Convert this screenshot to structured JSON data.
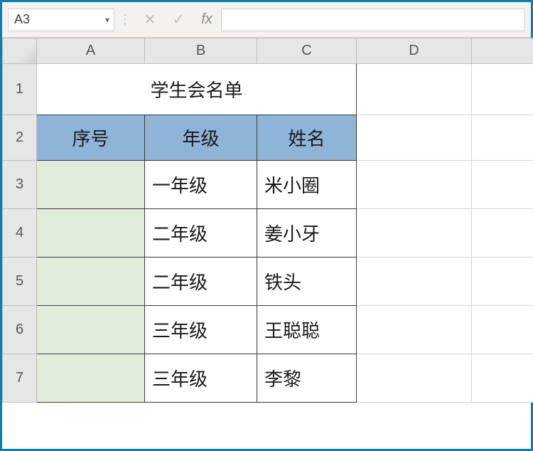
{
  "namebox": {
    "value": "A3"
  },
  "formula": {
    "value": ""
  },
  "fx_label": "fx",
  "columns": [
    "A",
    "B",
    "C",
    "D"
  ],
  "rows": [
    "1",
    "2",
    "3",
    "4",
    "5",
    "6",
    "7"
  ],
  "title": "学生会名单",
  "table_headers": {
    "seq": "序号",
    "grade": "年级",
    "name": "姓名"
  },
  "students": [
    {
      "seq": "",
      "grade": "一年级",
      "name": "米小圈"
    },
    {
      "seq": "",
      "grade": "二年级",
      "name": "姜小牙"
    },
    {
      "seq": "",
      "grade": "二年级",
      "name": "铁头"
    },
    {
      "seq": "",
      "grade": "三年级",
      "name": "王聪聪"
    },
    {
      "seq": "",
      "grade": "三年级",
      "name": "李黎"
    }
  ],
  "chart_data": {
    "type": "table",
    "title": "学生会名单",
    "columns": [
      "序号",
      "年级",
      "姓名"
    ],
    "rows": [
      [
        "",
        "一年级",
        "米小圈"
      ],
      [
        "",
        "二年级",
        "姜小牙"
      ],
      [
        "",
        "二年级",
        "铁头"
      ],
      [
        "",
        "三年级",
        "王聪聪"
      ],
      [
        "",
        "三年级",
        "李黎"
      ]
    ]
  },
  "colors": {
    "header_fill": "#8eb4d8",
    "selection_fill": "#e2ecdb",
    "frame_border": "#0b7fb3"
  }
}
